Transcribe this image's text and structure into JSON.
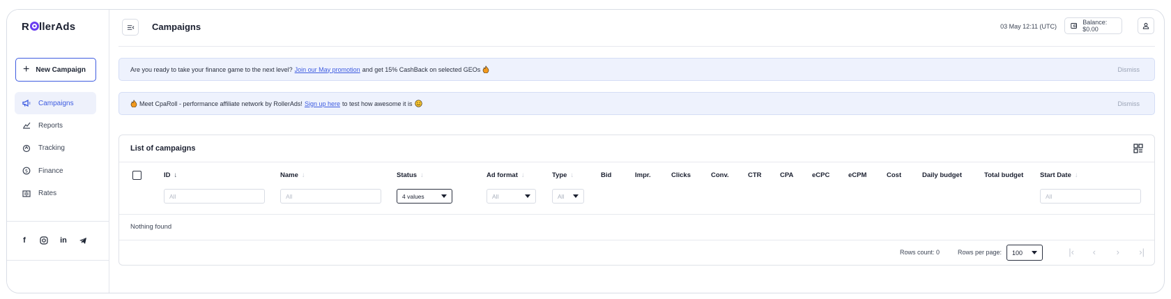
{
  "brand": {
    "name_left": "R",
    "name_right": "llerAds"
  },
  "sidebar": {
    "new_campaign_label": "New Campaign",
    "items": [
      {
        "label": "Campaigns",
        "icon": "megaphone-icon",
        "active": true
      },
      {
        "label": "Reports",
        "icon": "chart-icon"
      },
      {
        "label": "Tracking",
        "icon": "tracking-icon"
      },
      {
        "label": "Finance",
        "icon": "dollar-circle-icon"
      },
      {
        "label": "Rates",
        "icon": "rates-icon"
      }
    ],
    "social": {
      "facebook": "f",
      "instagram": "instagram-icon",
      "linkedin": "in",
      "telegram": "telegram-icon"
    }
  },
  "header": {
    "title": "Campaigns",
    "datetime": "03 May 12:11 (UTC)",
    "balance": "Balance: $0.00"
  },
  "banners": [
    {
      "before": "Are you ready to take your finance game to the next level?",
      "link": "Join our May promotion",
      "after": "and get 15% CashBack on selected GEOs",
      "dismiss": "Dismiss"
    },
    {
      "before": "Meet CpaRoll - performance affiliate network by RollerAds!",
      "link": "Sign up here",
      "after": "to test how awesome it is",
      "dismiss": "Dismiss"
    }
  ],
  "table": {
    "title": "List of campaigns",
    "columns": {
      "id": "ID",
      "name": "Name",
      "status": "Status",
      "ad_format": "Ad format",
      "type": "Type",
      "bid": "Bid",
      "impr": "Impr.",
      "clicks": "Clicks",
      "conv": "Conv.",
      "ctr": "CTR",
      "cpa": "CPA",
      "ecpc": "eCPC",
      "ecpm": "eCPM",
      "cost": "Cost",
      "daily_budget": "Daily budget",
      "total_budget": "Total budget",
      "start_date": "Start Date"
    },
    "filters": {
      "id_placeholder": "All",
      "name_placeholder": "All",
      "status_value": "4 values",
      "ad_format_value": "All",
      "type_value": "All",
      "start_date_placeholder": "All"
    },
    "empty_text": "Nothing found",
    "footer": {
      "rows_count": "Rows count: 0",
      "rows_per_page_label": "Rows per page:",
      "rows_per_page_value": "100"
    }
  },
  "colors": {
    "accent": "#3d5be0",
    "banner_bg": "#eef2fd",
    "logo": "#6a3df0"
  }
}
